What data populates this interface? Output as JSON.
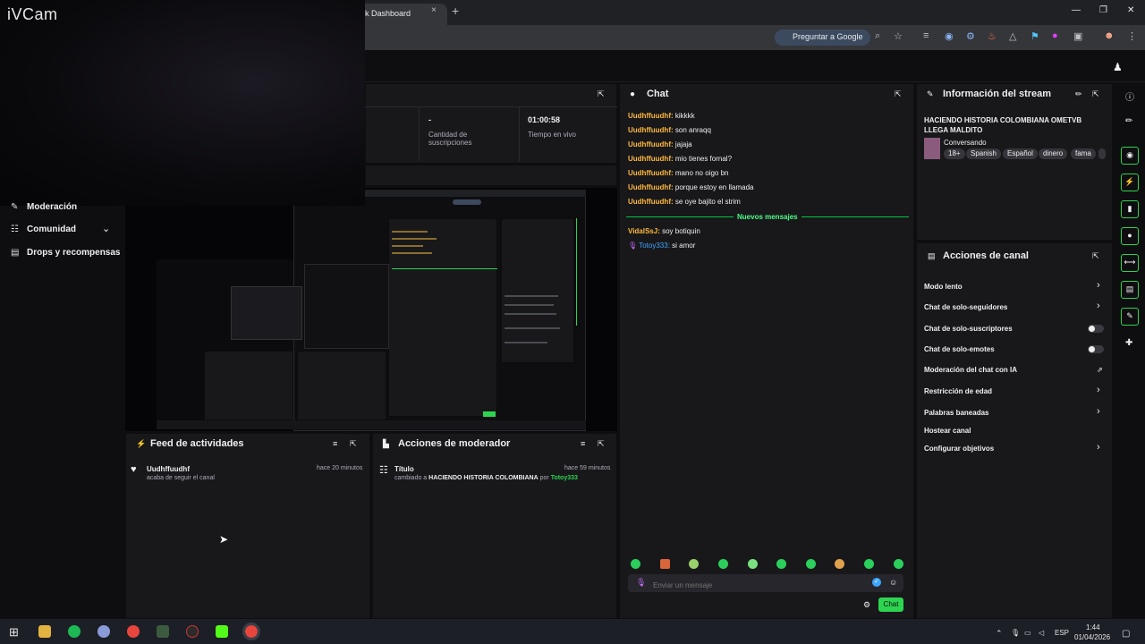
{
  "browser": {
    "tab_title": "k Dashboard",
    "tab_close": "×",
    "new_tab": "+",
    "ask_google": "Preguntar a Google",
    "win_min": "—",
    "win_max": "❐",
    "win_close": "✕"
  },
  "webcam": {
    "label": "iVCam"
  },
  "sidebar": {
    "items": [
      {
        "label": "Moderación",
        "icon": "wrench-icon"
      },
      {
        "label": "Comunidad",
        "icon": "community-icon"
      },
      {
        "label": "Drops y recompensas",
        "icon": "gift-icon"
      }
    ]
  },
  "stats": {
    "subs_value": "-",
    "subs_label": "Cantidad de suscripciones",
    "time_value": "01:00:58",
    "time_label": "Tiempo en vivo"
  },
  "activity_feed": {
    "title": "Feed de actividades",
    "items": [
      {
        "user": "Uudhffuudhf",
        "time": "hace 20 minutos",
        "text": "acaba de seguir el canal"
      }
    ]
  },
  "mod_actions": {
    "title": "Acciones de moderador",
    "items": [
      {
        "title": "Título",
        "time": "hace 59 minutos",
        "prefix": "cambiado a",
        "value": "HACIENDO HISTORIA COLOMBIANA",
        "by": "por",
        "user": "Totoy333"
      }
    ]
  },
  "chat": {
    "title": "Chat",
    "messages": [
      {
        "user": "Uudhffuudhf:",
        "text": "kikkkk"
      },
      {
        "user": "Uudhffuudhf:",
        "text": "son anraqq"
      },
      {
        "user": "Uudhffuudhf:",
        "text": "jajaja"
      },
      {
        "user": "Uudhffuudhf:",
        "text": "mio tienes fornal?"
      },
      {
        "user": "Uudhffuudhf:",
        "text": "mano no oigo bn"
      },
      {
        "user": "Uudhffuudhf:",
        "text": "porque estoy en llamada"
      },
      {
        "user": "Uudhffuudhf:",
        "text": "se oye bajito el strim"
      }
    ],
    "new_messages_label": "Nuevos mensajes",
    "new_messages": [
      {
        "user": "VidalSsJ:",
        "text": "soy botiquin"
      },
      {
        "user": "Totoy333:",
        "text": "si amor"
      }
    ],
    "input_placeholder": "Enviar un mensaje",
    "send_label": "Chat"
  },
  "stream_info": {
    "title": "Información del stream",
    "stream_title": "HACIENDO HISTORIA COLOMBIANA OMETVB LLEGA MALDITO",
    "category": "Conversando",
    "tags": [
      "18+",
      "Spanish",
      "Español",
      "dinero",
      "fama"
    ]
  },
  "channel_actions": {
    "title": "Acciones de canal",
    "items": [
      {
        "label": "Modo lento",
        "control": "chevron"
      },
      {
        "label": "Chat de solo-seguidores",
        "control": "chevron"
      },
      {
        "label": "Chat de solo-suscriptores",
        "control": "toggle"
      },
      {
        "label": "Chat de solo-emotes",
        "control": "toggle"
      },
      {
        "label": "Moderación del chat con IA",
        "control": "external"
      },
      {
        "label": "Restricción de edad",
        "control": "chevron"
      },
      {
        "label": "Palabras baneadas",
        "control": "chevron"
      },
      {
        "label": "Hostear canal",
        "control": "none"
      },
      {
        "label": "Configurar objetivos",
        "control": "chevron"
      }
    ]
  },
  "taskbar": {
    "lang": "ESP",
    "time": "1:44",
    "date": "01/04/2026"
  },
  "colors": {
    "accent": "#2dd44f",
    "username": "#ffb93b",
    "background": "#0e0e10",
    "panel": "#18181b"
  }
}
